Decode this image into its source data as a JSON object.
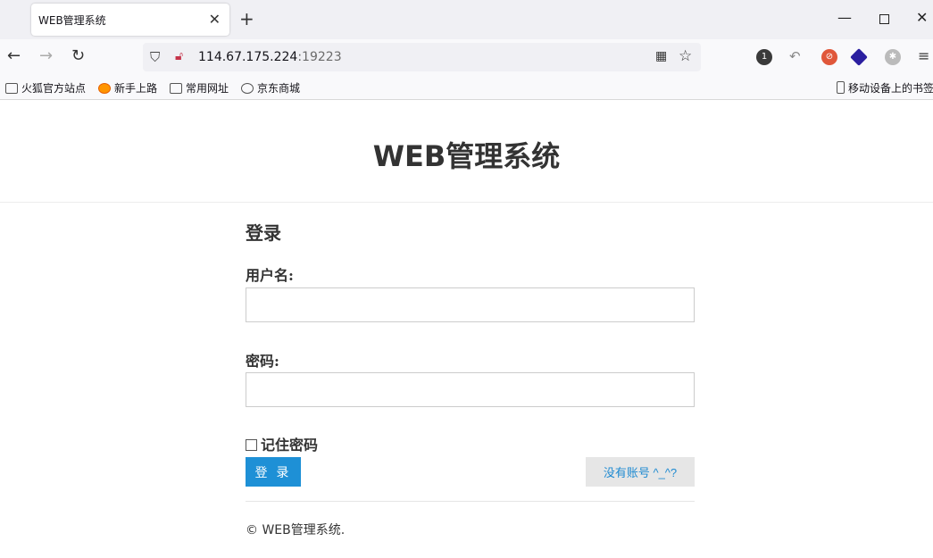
{
  "browser": {
    "tab_title": "WEB管理系统",
    "url_host": "114.67.175.224",
    "url_port": ":19223",
    "bookmarks": [
      "火狐官方站点",
      "新手上路",
      "常用网址",
      "京东商城"
    ],
    "mobile_bookmarks": "移动设备上的书签",
    "extension_badge": "1"
  },
  "page": {
    "site_title": "WEB管理系统",
    "form_heading": "登录",
    "username_label": "用户名:",
    "username_value": "",
    "password_label": "密码:",
    "password_value": "",
    "remember_label": "记住密码",
    "remember_checked": false,
    "login_button": "登 录",
    "signup_button": "没有账号 ^_^?",
    "footer": "© WEB管理系统."
  },
  "colors": {
    "primary_button": "#1e90d6",
    "link": "#1e8ad1"
  }
}
